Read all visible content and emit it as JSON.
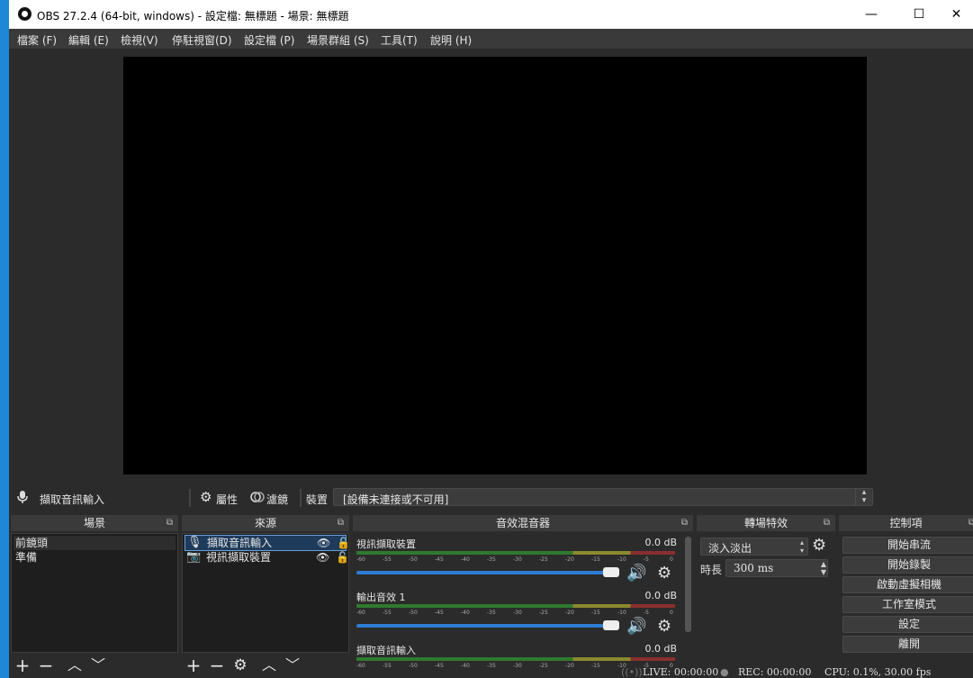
{
  "window": {
    "title": "OBS 27.2.4 (64-bit, windows) - 設定檔: 無標題 - 場景: 無標題",
    "minimize": "—",
    "maximize": "☐",
    "close": "✕"
  },
  "menu": [
    "檔案 (F)",
    "編輯 (E)",
    "檢視(V)",
    "停駐視窗(D)",
    "設定檔 (P)",
    "場景群組 (S)",
    "工具(T)",
    "說明 (H)"
  ],
  "source_toolbar": {
    "source_name": "擷取音訊輸入",
    "properties": "屬性",
    "filters": "濾鏡",
    "device_label": "裝置",
    "device_value": "[設備未連接或不可用]"
  },
  "scenes": {
    "title": "場景",
    "items": [
      "前鏡頭",
      "準備"
    ]
  },
  "sources": {
    "title": "來源",
    "items": [
      "擷取音訊輸入",
      "視訊擷取裝置"
    ]
  },
  "mixer": {
    "title": "音效混音器",
    "ticks": [
      "-60",
      "-55",
      "-50",
      "-45",
      "-40",
      "-35",
      "-30",
      "-25",
      "-20",
      "-15",
      "-10",
      "-5",
      "0"
    ],
    "channels": [
      {
        "name": "視訊擷取裝置",
        "db": "0.0 dB"
      },
      {
        "name": "輸出音效 1",
        "db": "0.0 dB"
      },
      {
        "name": "擷取音訊輸入",
        "db": "0.0 dB"
      }
    ]
  },
  "transitions": {
    "title": "轉場特效",
    "selected": "淡入淡出",
    "duration_label": "時長",
    "duration_value": "300 ms"
  },
  "controls": {
    "title": "控制項",
    "buttons": [
      "開始串流",
      "開始錄製",
      "啟動虛擬相機",
      "工作室模式",
      "設定",
      "離開"
    ]
  },
  "status": {
    "live": "LIVE: 00:00:00",
    "rec": "REC: 00:00:00",
    "cpu": "CPU: 0.1%, 30.00 fps"
  }
}
